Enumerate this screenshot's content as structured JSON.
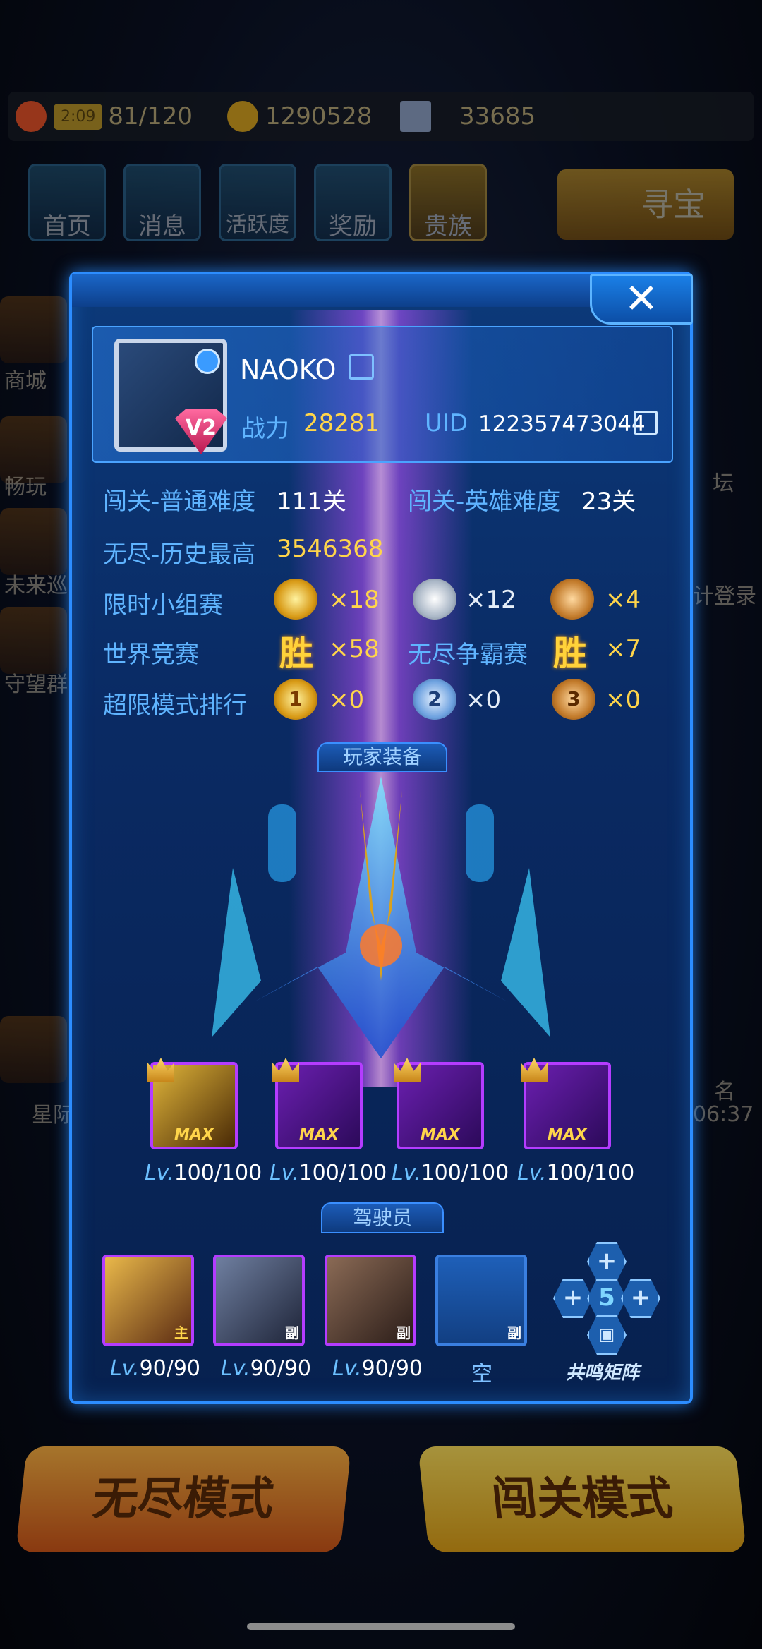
{
  "resources": {
    "energy_timer": "2:09",
    "energy": "81/120",
    "coins": "1290528",
    "diamonds": "33685"
  },
  "nav": {
    "home": "首页",
    "messages": "消息",
    "activity": "活跃度",
    "rewards": "奖励",
    "noble": "贵族",
    "treasure": "寻宝"
  },
  "side": {
    "shop": "商城",
    "play": "畅玩",
    "future": "未来巡",
    "guard": "守望群",
    "star": "星际",
    "forum": "坛",
    "login": "计登录",
    "rank_badge": "名",
    "rank_time": "06:37"
  },
  "profile": {
    "name": "NAOKO",
    "power_label": "战力",
    "power": "28281",
    "uid_label": "UID",
    "uid": "122357473044",
    "vip": "V2"
  },
  "stats": {
    "normal_label": "闯关-普通难度",
    "normal_value": "111关",
    "hero_label": "闯关-英雄难度",
    "hero_value": "23关",
    "endless_label": "无尽-历史最高",
    "endless_value": "3546368",
    "group_label": "限时小组赛",
    "group_gold": "×18",
    "group_silver": "×12",
    "group_bronze": "×4",
    "world_label": "世界竞赛",
    "win_glyph": "胜",
    "world_wins": "×58",
    "endless_pvp_label": "无尽争霸赛",
    "endless_pvp_wins": "×7",
    "extreme_label": "超限模式排行",
    "extreme_1": "×0",
    "extreme_2": "×0",
    "extreme_3": "×0",
    "rank1": "1",
    "rank2": "2",
    "rank3": "3"
  },
  "equipment": {
    "title": "玩家装备",
    "max_label": "MAX",
    "items": [
      {
        "lv_prefix": "Lv.",
        "lv": "100/100"
      },
      {
        "lv_prefix": "Lv.",
        "lv": "100/100"
      },
      {
        "lv_prefix": "Lv.",
        "lv": "100/100"
      },
      {
        "lv_prefix": "Lv.",
        "lv": "100/100"
      }
    ]
  },
  "pilots": {
    "title": "驾驶员",
    "items": [
      {
        "tag": "主",
        "lv_prefix": "Lv.",
        "lv": "90/90"
      },
      {
        "tag": "副",
        "lv_prefix": "Lv.",
        "lv": "90/90"
      },
      {
        "tag": "副",
        "lv_prefix": "Lv.",
        "lv": "90/90"
      },
      {
        "tag": "副",
        "empty_label": "空"
      }
    ],
    "matrix_label": "共鸣矩阵",
    "matrix_center": "5"
  },
  "modes": {
    "endless": "无尽模式",
    "stage": "闯关模式"
  },
  "colors": {
    "accent_blue": "#2c8dff",
    "gold": "#ffd54a",
    "label_blue": "#5fb4ff"
  }
}
